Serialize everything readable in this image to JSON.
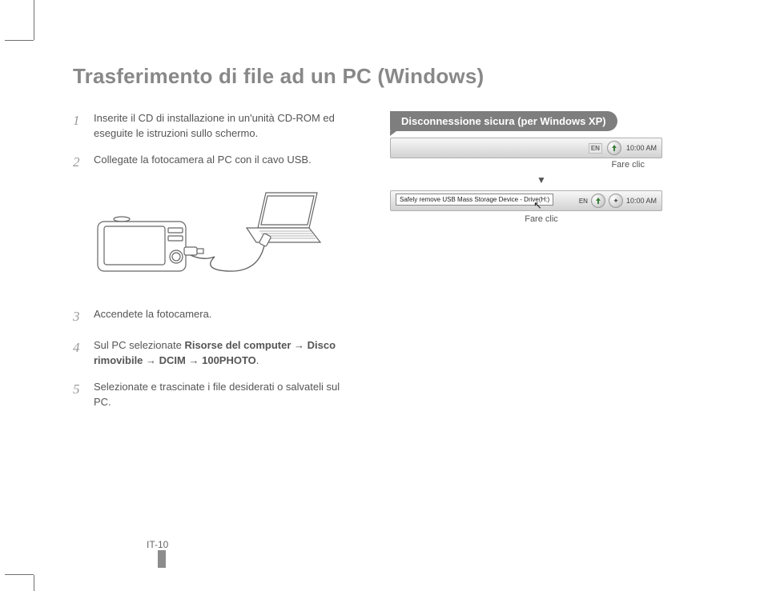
{
  "title": "Trasferimento di file ad un PC (Windows)",
  "steps": {
    "s1": {
      "num": "1",
      "text": "Inserite il CD di installazione in un'unità CD-ROM ed eseguite le istruzioni sullo schermo."
    },
    "s2": {
      "num": "2",
      "text": "Collegate la fotocamera al PC con il cavo USB."
    },
    "s3": {
      "num": "3",
      "text": "Accendete la fotocamera."
    },
    "s4": {
      "num": "4",
      "prefix": "Sul PC selezionate ",
      "b1": "Risorse del computer",
      "arrow": " → ",
      "b2": "Disco rimovibile",
      "b3": "DCIM",
      "b4": "100PHOTO",
      "suffix": "."
    },
    "s5": {
      "num": "5",
      "text": "Selezionate e trascinate i file desiderati o salvateli sul PC."
    }
  },
  "right": {
    "heading": "Disconnessione sicura (per Windows XP)",
    "lang": "EN",
    "time": "10:00 AM",
    "click": "Fare clic",
    "arrow": "▼",
    "tooltip": "Safely remove USB Mass Storage Device - Drive(H:)"
  },
  "footer": "IT-10"
}
